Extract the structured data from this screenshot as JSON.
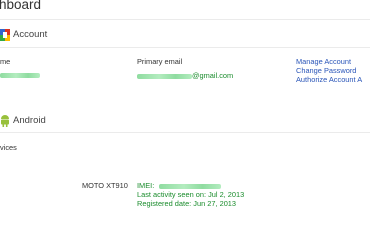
{
  "header": {
    "title": "hboard"
  },
  "account": {
    "section_label": "Account",
    "name_header": "me",
    "email_header": "Primary email",
    "email_suffix": "@gmail.com",
    "links": [
      "Manage Account",
      "Change Password",
      "Authorize Account A"
    ]
  },
  "android": {
    "section_label": "Android",
    "devices_label": "vices",
    "device": {
      "model": "MOTO XT910",
      "imei_label": "IMEI:",
      "last_activity": "Last activity seen on: Jul 2, 2013",
      "registered": "Registered date: Jun 27, 2013"
    }
  },
  "icons": {
    "account": "google-account-icon",
    "android": "android-robot-icon"
  },
  "colors": {
    "link": "#2a55b8",
    "green_text": "#1a8c2c",
    "redaction": "#8fdca0",
    "android_green": "#98c03b"
  }
}
